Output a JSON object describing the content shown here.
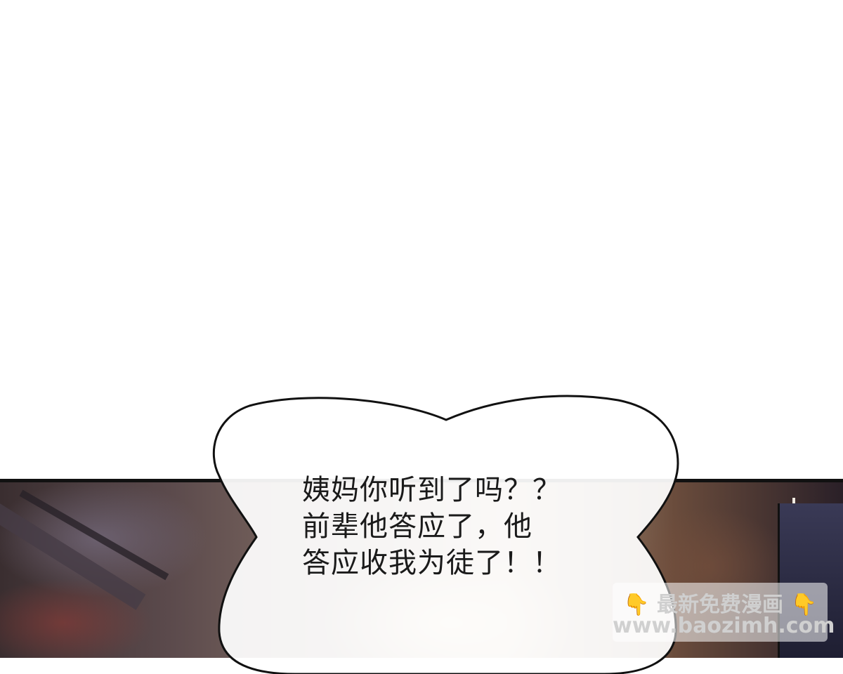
{
  "dialogue": {
    "lines": [
      "姨妈你听到了吗？？",
      "前辈他答应了，他",
      "答应收我为徒了！！"
    ]
  },
  "watermark": {
    "line1": "最新免费漫画",
    "line2": "www.baozimh.com",
    "icon_left": "pointing-down-hand-icon",
    "icon_right": "pointing-down-hand-icon",
    "icon_color": "#e8a318"
  },
  "colors": {
    "panel_border": "#111111",
    "bubble_fill": "#ffffff"
  }
}
